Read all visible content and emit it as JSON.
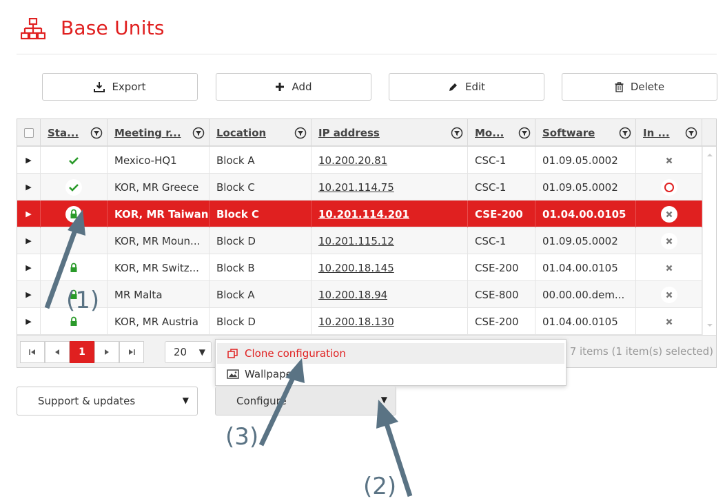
{
  "header": {
    "title": "Base Units",
    "icon": "network-icon",
    "accent": "#e02020"
  },
  "toolbar": {
    "export": "Export",
    "add": "Add",
    "edit": "Edit",
    "delete": "Delete"
  },
  "columns": [
    "Sta...",
    "Meeting r...",
    "Location",
    "IP address",
    "Mo...",
    "Software",
    "In ..."
  ],
  "rows": [
    {
      "status": "check",
      "meeting": "Mexico-HQ1",
      "location": "Block A",
      "ip": "10.200.20.81",
      "model": "CSC-1",
      "software": "01.09.05.0002",
      "info": "x"
    },
    {
      "status": "check",
      "meeting": "KOR, MR Greece",
      "location": "Block C",
      "ip": "10.201.114.75",
      "model": "CSC-1",
      "software": "01.09.05.0002",
      "info": "circle"
    },
    {
      "status": "lock",
      "meeting": "KOR, MR Taiwan",
      "location": "Block C",
      "ip": "10.201.114.201",
      "model": "CSE-200",
      "software": "01.04.00.0105",
      "info": "x",
      "selected": true
    },
    {
      "status": "none",
      "meeting": "KOR, MR Moun...",
      "location": "Block D",
      "ip": "10.201.115.12",
      "model": "CSC-1",
      "software": "01.09.05.0002",
      "info": "x"
    },
    {
      "status": "lock",
      "meeting": "KOR, MR Switz...",
      "location": "Block B",
      "ip": "10.200.18.145",
      "model": "CSE-200",
      "software": "01.04.00.0105",
      "info": "x"
    },
    {
      "status": "lock",
      "meeting": "MR Malta",
      "location": "Block A",
      "ip": "10.200.18.94",
      "model": "CSE-800",
      "software": "00.00.00.dem...",
      "info": "x"
    },
    {
      "status": "lock",
      "meeting": "KOR, MR Austria",
      "location": "Block D",
      "ip": "10.200.18.130",
      "model": "CSE-200",
      "software": "01.04.00.0105",
      "info": "x"
    }
  ],
  "pager": {
    "current": "1",
    "page_size": "20",
    "info": "7 items (1 item(s) selected)"
  },
  "menu": {
    "clone": "Clone configuration",
    "wallpaper": "Wallpaper"
  },
  "bottom": {
    "support": "Support & updates",
    "configure": "Configure"
  },
  "callouts": {
    "one": "(1)",
    "two": "(2)",
    "three": "(3)"
  }
}
